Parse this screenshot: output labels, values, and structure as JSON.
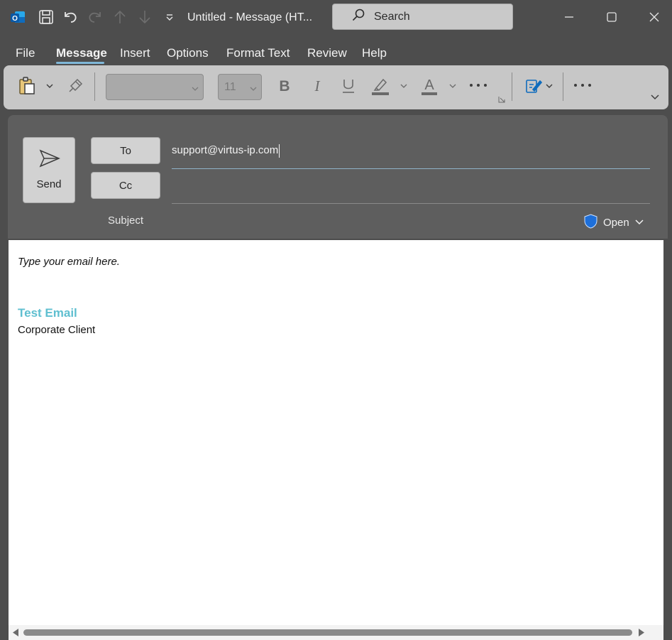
{
  "titlebar": {
    "title": "Untitled  -  Message (HT...",
    "search_placeholder": "Search"
  },
  "menu": {
    "tabs": [
      "File",
      "Message",
      "Insert",
      "Options",
      "Format Text",
      "Review",
      "Help"
    ],
    "active_tab": "Message"
  },
  "ribbon": {
    "font_size": "11"
  },
  "compose": {
    "send_label": "Send",
    "to_label": "To",
    "cc_label": "Cc",
    "to_value": "support@virtus-ip.com",
    "cc_value": "",
    "subject_label": "Subject",
    "sensitivity_label": "Open"
  },
  "body": {
    "placeholder": "Type your email here.",
    "signature_name": "Test Email",
    "signature_company": "Corporate Client"
  },
  "colors": {
    "accent": "#7fb7d8",
    "signature": "#5fbfd0",
    "outlook_blue": "#0f6cbd",
    "shield_blue": "#1e6fd9"
  }
}
